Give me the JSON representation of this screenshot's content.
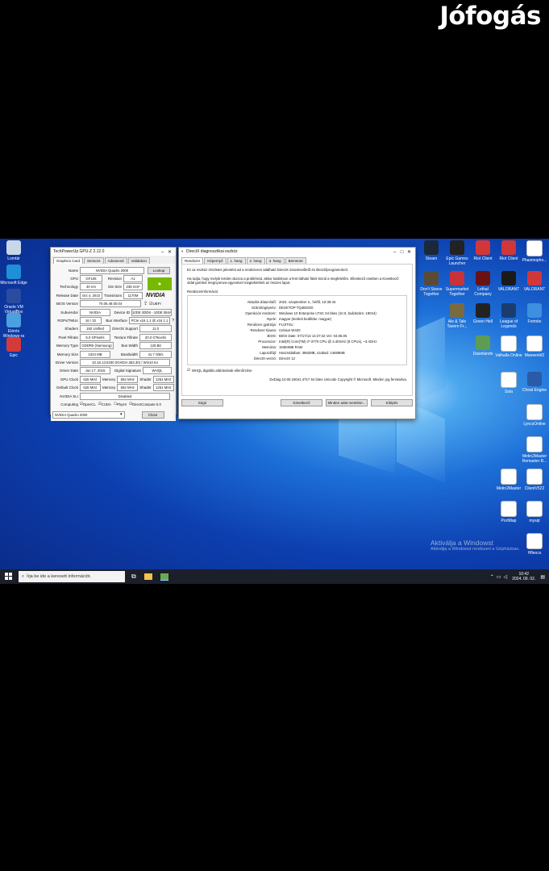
{
  "brand": "Jófogás",
  "desktop": {
    "left_icons": [
      "Lomtár",
      "Microsoft Edge",
      "Oracle VM VirtualBox",
      "Elérés Windows-ra",
      "Epic"
    ],
    "right_icons": [
      {
        "label": "Steam",
        "color": "#1b2838"
      },
      {
        "label": "Epic Games Launcher",
        "color": "#222"
      },
      {
        "label": "Riot Client",
        "color": "#d13639"
      },
      {
        "label": "Riot Client",
        "color": "#d13639"
      },
      {
        "label": "Phasmopho...",
        "color": "#ffffff"
      },
      {
        "label": "Don't Starve Together",
        "color": "#5a4b36"
      },
      {
        "label": "Supermarket Together",
        "color": "#c8323a"
      },
      {
        "label": "Lethal Company",
        "color": "#6a1212"
      },
      {
        "label": "VALORANT",
        "color": "#1a1a1a"
      },
      {
        "label": "VALORANT",
        "color": "#d13639"
      },
      {
        "label": "Ale & Tale Tavern Fr...",
        "color": "#7a6a40"
      },
      {
        "label": "Green Hell",
        "color": "#222"
      },
      {
        "label": "League of Legends",
        "color": "#1a3c6e"
      },
      {
        "label": "Fortnite",
        "color": "#3d8fe0"
      },
      {
        "label": "Dawnlands",
        "color": "#5d9c52"
      },
      {
        "label": "Valhalla Online",
        "color": "#ffffff"
      },
      {
        "label": "Maeworld2",
        "color": "#ffffff"
      },
      {
        "label": "Sola",
        "color": "#ffffff"
      },
      {
        "label": "Cheat Engine",
        "color": "#2a5ba8"
      },
      {
        "label": "LyncsOnline",
        "color": "#ffffff"
      },
      {
        "label": "Metin2Master Remaster B...",
        "color": "#ffffff"
      },
      {
        "label": "Metin2Master",
        "color": "#ffffff"
      },
      {
        "label": "ClientV522",
        "color": "#ffffff"
      },
      {
        "label": "PortMap",
        "color": "#ffffff"
      },
      {
        "label": "mysql",
        "color": "#ffffff"
      },
      {
        "label": "Hfleocs",
        "color": "#ffffff"
      }
    ],
    "watermark_title": "Aktiválja a Windowst",
    "watermark_sub": "Aktiválja a Windowst rendszert a Gépházban."
  },
  "gpuz": {
    "title": "TechPowerUp GPU-Z 2.12.0",
    "tabs": [
      "Graphics Card",
      "Sensors",
      "Advanced",
      "Validation"
    ],
    "name": "NVIDIA Quadro 2000",
    "lookup": "Lookup",
    "gpu": "GF106",
    "revision_label": "Revision",
    "revision": "A1",
    "technology": "40 nm",
    "die_size_label": "Die Size",
    "die_size": "238 mm²",
    "release_date": "Oct 4, 2010",
    "transistors_label": "Transistors",
    "transistors": "1170M",
    "bios_version": "70.06.48.00.04",
    "uefi": "UEFI",
    "subvendor": "NVIDIA",
    "device_id_label": "Device ID",
    "device_id": "10DE 0DD8 - 10DE 084A",
    "rops": "16 / 32",
    "bus_interface_label": "Bus Interface",
    "bus_interface": "PCIe x16 1.1 @ x16 1.1",
    "shaders": "192 Unified",
    "directx_label": "DirectX Support",
    "directx": "11.0",
    "pixel_fillrate": "5.0 GPixel/s",
    "texture_fillrate_label": "Texture Fillrate",
    "texture_fillrate": "20.0 GTexel/s",
    "memory_type": "GDDR5 (Samsung)",
    "bus_width_label": "Bus Width",
    "bus_width": "128 Bit",
    "memory_size": "1024 MB",
    "bandwidth_label": "Bandwidth",
    "bandwidth": "41.7 GB/s",
    "driver_version": "10.18.13.5330 (NVIDIA 353.30) / Win10 64",
    "driver_date": "Jun 17, 2015",
    "digital_signature_label": "Digital Signature",
    "digital_signature": "WHQL",
    "gpu_clock": "626 MHz",
    "memory_clock": "652 MHz",
    "shader_clock": "1251 MHz",
    "default_clock": "626 MHz",
    "default_memory": "652 MHz",
    "default_shader": "1251 MHz",
    "sli": "Disabled",
    "computing": [
      "OpenCL",
      "CUDA",
      "PhysX",
      "DirectCompute 5.0"
    ],
    "footer_select": "NVIDIA Quadro 2000",
    "close": "Close",
    "labels": {
      "name": "Name",
      "gpu": "GPU",
      "technology": "Technology",
      "release_date": "Release Date",
      "bios": "BIOS Version",
      "subvendor": "Subvendor",
      "rops": "ROPs/TMUs",
      "shaders": "Shaders",
      "pixel": "Pixel Fillrate",
      "mem_type": "Memory Type",
      "mem_size": "Memory Size",
      "driver_version": "Driver Version",
      "driver_date": "Driver Date",
      "gpu_clock": "GPU Clock",
      "default_clock": "Default Clock",
      "memory": "Memory",
      "shader": "Shader",
      "sli": "NVIDIA SLI",
      "computing": "Computing"
    }
  },
  "dxdiag": {
    "title": "DirectX diagnosztikai eszköz",
    "tabs": [
      "Rendszer",
      "Képernyő",
      "1. hang",
      "2. hang",
      "3. hang",
      "Bemenet"
    ],
    "intro1": "Ez az eszköz részletes jelentést ad a rendszeren található DirectX összetevőkről és illesztőprogramokról.",
    "intro2": "Ha tudja, hogy melyik terület okozza a problémát, akkor kattintson a fent látható fülek közül a megfelelőre. Ellenkező esetben a Következő oldal gombot megnyomva egyesével megtekintheti az összes lapot.",
    "group_title": "Rendszerinformáció",
    "rows": [
      {
        "k": "Aktuális dátum/idő:",
        "v": "2024. szeptember 2., hétfő, 10:39:43"
      },
      {
        "k": "Számítógépnév:",
        "v": "DESKTOP-TQ4BSOD"
      },
      {
        "k": "Operációs rendszer:",
        "v": "Windows 10 Enterprise LTSC 64 bites (10.0, buildszám: 19044)"
      },
      {
        "k": "Nyelv:",
        "v": "magyar (területi beállítás: magyar)"
      },
      {
        "k": "Rendszer gyártója:",
        "v": "FUJITSU"
      },
      {
        "k": "Rendszer típusa:",
        "v": "Celsius W420"
      },
      {
        "k": "BIOS:",
        "v": "BIOS Date: 07/17/13 14:27:42 Ver: 04.06.05"
      },
      {
        "k": "Processzor:",
        "v": "Intel(R) Core(TM) i7-3770 CPU @ 3.40GHz (8 CPUs), ~3.4GHz"
      },
      {
        "k": "Memória:",
        "v": "16384MB RAM"
      },
      {
        "k": "Lapozófájl:",
        "v": "Használatban: 3862MB, szabad: 14658MB"
      },
      {
        "k": "DirectX-verzió:",
        "v": "DirectX 12"
      }
    ],
    "whql": "WHQL digitális aláírásának ellenőrzése",
    "footer_line": "DxDiag 10.00.19041.4717 64 bites Unicode  Copyright © Microsoft. Minden jog fenntartva.",
    "buttons": {
      "help": "Súgó",
      "next": "Következő",
      "save": "Minden adat mentése...",
      "exit": "Kilépés"
    }
  },
  "taskbar": {
    "search_placeholder": "Írja be ide a keresett információt.",
    "time": "10:42",
    "date": "2024. 09. 02."
  }
}
